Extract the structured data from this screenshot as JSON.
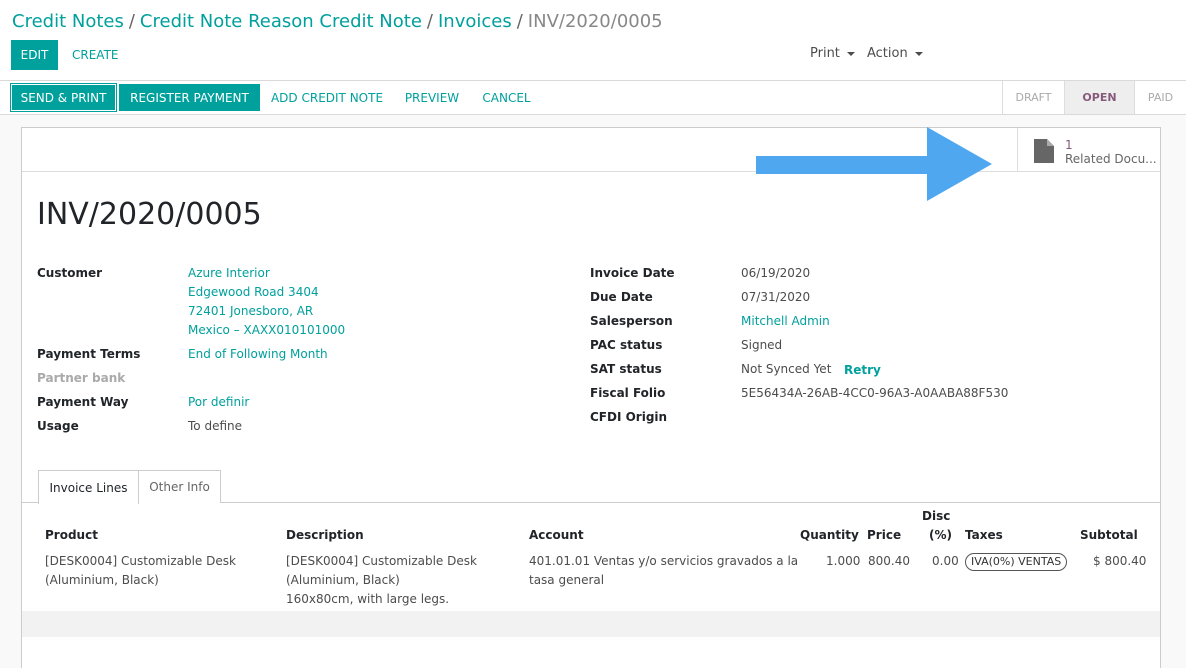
{
  "breadcrumb": {
    "items": [
      "Credit Notes",
      "Credit Note Reason Credit Note",
      "Invoices"
    ],
    "separator": "/",
    "current": "INV/2020/0005"
  },
  "toolbar": {
    "edit_label": "EDIT",
    "create_label": "CREATE",
    "print_label": "Print",
    "action_label": "Action"
  },
  "actions": {
    "send_print": "SEND & PRINT",
    "register_payment": "REGISTER PAYMENT",
    "add_credit_note": "ADD CREDIT NOTE",
    "preview": "PREVIEW",
    "cancel": "CANCEL"
  },
  "statusbar": {
    "stages": [
      "DRAFT",
      "OPEN",
      "PAID"
    ],
    "active": "OPEN"
  },
  "smart_button": {
    "count": "1",
    "label": "Related Docu..."
  },
  "invoice": {
    "title": "INV/2020/0005",
    "left_fields": {
      "customer_label": "Customer",
      "customer_lines": [
        "Azure Interior",
        "Edgewood Road 3404",
        "72401 Jonesboro, AR",
        "Mexico – XAXX010101000"
      ],
      "payment_terms_label": "Payment Terms",
      "payment_terms_value": "End of Following Month",
      "partner_bank_label": "Partner bank",
      "payment_way_label": "Payment Way",
      "payment_way_value": "Por definir",
      "usage_label": "Usage",
      "usage_value": "To define"
    },
    "right_fields": {
      "invoice_date_label": "Invoice Date",
      "invoice_date_value": "06/19/2020",
      "due_date_label": "Due Date",
      "due_date_value": "07/31/2020",
      "salesperson_label": "Salesperson",
      "salesperson_value": "Mitchell Admin",
      "pac_status_label": "PAC status",
      "pac_status_value": "Signed",
      "sat_status_label": "SAT status",
      "sat_status_value": "Not Synced Yet",
      "retry_label": "Retry",
      "fiscal_folio_label": "Fiscal Folio",
      "fiscal_folio_value": "5E56434A-26AB-4CC0-96A3-A0AABA88F530",
      "cfdi_origin_label": "CFDI Origin"
    }
  },
  "tabs": [
    "Invoice Lines",
    "Other Info"
  ],
  "lines_table": {
    "headers": {
      "product": "Product",
      "description": "Description",
      "account": "Account",
      "quantity": "Quantity",
      "price": "Price",
      "disc_top": "Disc",
      "disc_bottom": "(%)",
      "taxes": "Taxes",
      "subtotal": "Subtotal"
    },
    "rows": [
      {
        "product": [
          "[DESK0004] Customizable Desk",
          "(Aluminium, Black)"
        ],
        "description": [
          "[DESK0004] Customizable Desk",
          "(Aluminium, Black)",
          "160x80cm, with large legs."
        ],
        "account": [
          "401.01.01 Ventas y/o servicios gravados a la",
          "tasa general"
        ],
        "quantity": "1.000",
        "price": "800.40",
        "disc": "0.00",
        "taxes": "IVA(0%) VENTAS",
        "subtotal": "$ 800.40"
      }
    ]
  },
  "colors": {
    "accent": "#00A09D",
    "status_active": "#875A7B",
    "annotation_arrow": "#4FA8EF"
  }
}
